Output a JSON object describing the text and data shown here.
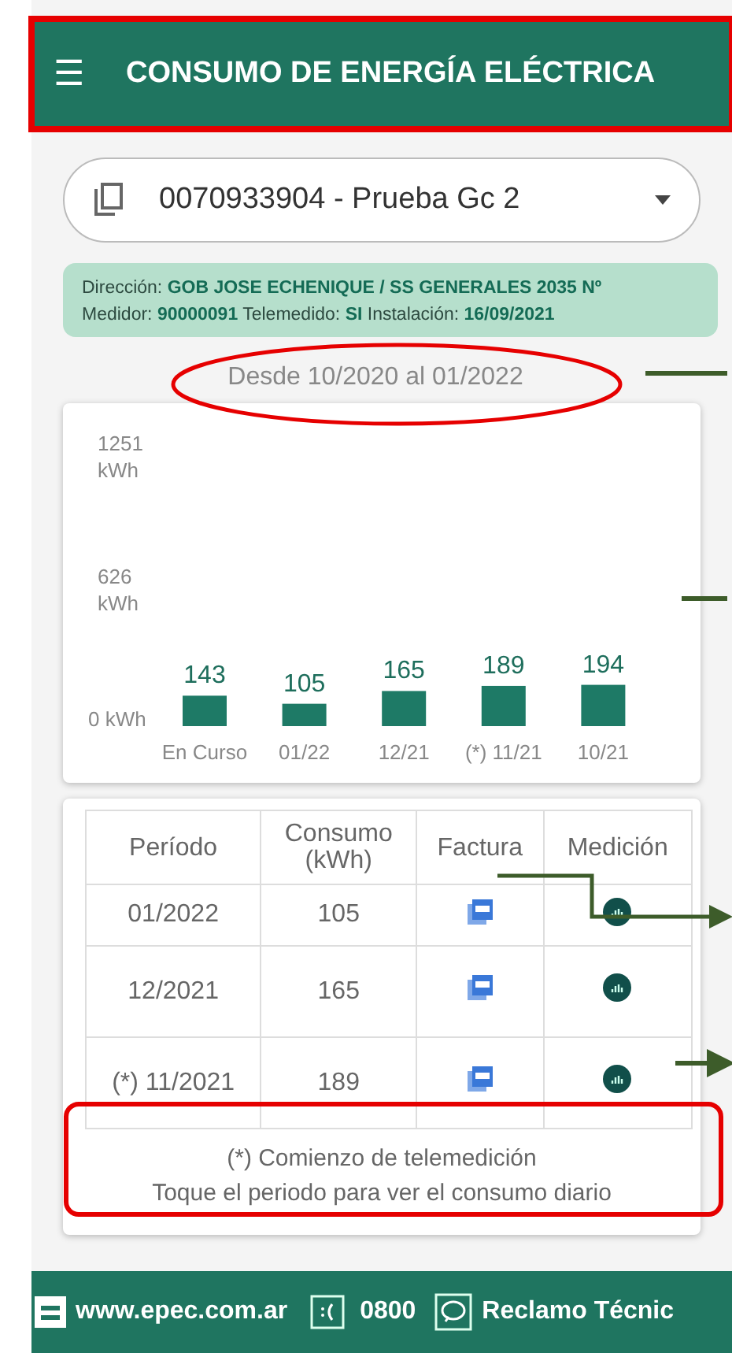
{
  "app_bar": {
    "menu_icon": "☰",
    "title": "CONSUMO DE ENERGÍA ELÉCTRICA"
  },
  "account_selector": {
    "value": "0070933904 - Prueba Gc 2"
  },
  "info_card": {
    "lines": [
      "Dirección: **GOB JOSE ECHENIQUE / SS GENERALES 2035 Nº**",
      "Medidor: **90000091** Telemedido: **SI** Instalación: **16/09/2021**"
    ]
  },
  "period": "Desde 10/2020 al 01/2022",
  "chart_data": {
    "type": "bar",
    "categories": [
      "En Curso",
      "01/22",
      "12/21",
      "(*) 11/21",
      "10/21"
    ],
    "series": [
      {
        "color": "#1e7a66",
        "values": [
          143,
          105,
          165,
          189,
          194
        ]
      }
    ],
    "ylim": [
      0,
      1251
    ],
    "yticks": [
      {
        "value": 0,
        "label": "0 kWh"
      },
      {
        "value": 626,
        "label": "626 kWh"
      },
      {
        "value": 1251,
        "label": "1251 kWh"
      }
    ],
    "data_labels": true
  },
  "table": {
    "columns": [
      "Período",
      "Consumo (kWh)",
      "Factura",
      "Medición"
    ],
    "rows": [
      {
        "period": "01/2022",
        "consumo": "105"
      },
      {
        "period": "12/2021",
        "consumo": "165"
      },
      {
        "period": "(*) 11/2021",
        "consumo": "189"
      }
    ]
  },
  "footnotes": [
    "(*) Comienzo de telemedición",
    "Toque el periodo para ver el consumo diario"
  ],
  "footer": {
    "website": "www.epec.com.ar",
    "phone": "0800",
    "claim": "Reclamo Técnic"
  }
}
